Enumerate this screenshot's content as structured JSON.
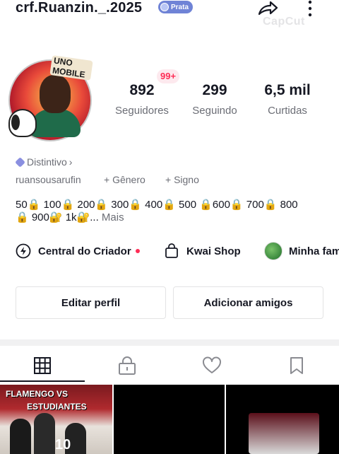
{
  "header": {
    "username": "crf.Ruanzin._.2025",
    "badge_label": "Prata",
    "watermark": "CapCut"
  },
  "profile": {
    "avatar_text": "UNO MOBILE",
    "notification_badge": "99+",
    "stats": [
      {
        "value": "892",
        "label": "Seguidores"
      },
      {
        "value": "299",
        "label": "Seguindo"
      },
      {
        "value": "6,5 mil",
        "label": "Curtidas"
      }
    ],
    "distintivo_label": "Distintivo",
    "distintivo_chevron": "›",
    "handle": "ruansousarufin",
    "add_gender": "+ Gênero",
    "add_sign": "+ Signo",
    "bio_line1": "50🔒 100🔒 200🔒 300🔒 400🔒 500 🔒600🔒 700🔒 800",
    "bio_line2": "🔒 900🔐 1k🔐...",
    "bio_more": "Mais"
  },
  "shortcuts": [
    {
      "label": "Central do Criador",
      "icon": "lightning-icon"
    },
    {
      "label": "Kwai Shop",
      "icon": "shopping-bag-icon"
    },
    {
      "label": "Minha família",
      "icon": "family-avatar-icon"
    }
  ],
  "actions": {
    "edit_profile": "Editar perfil",
    "add_friends": "Adicionar amigos"
  },
  "tabs": [
    {
      "name": "grid-tab",
      "icon": "grid-icon",
      "active": true
    },
    {
      "name": "private-tab",
      "icon": "lock-icon",
      "active": false
    },
    {
      "name": "likes-tab",
      "icon": "heart-icon",
      "active": false
    },
    {
      "name": "saved-tab",
      "icon": "bookmark-icon",
      "active": false
    }
  ],
  "posts": [
    {
      "title_line1": "FLAMENGO VS",
      "title_line2": "ESTUDIANTES",
      "jersey_number": "10"
    },
    {},
    {}
  ],
  "colors": {
    "accent": "#fe2c55",
    "badge_prata": "#6f83d6",
    "text_primary": "#161823",
    "text_secondary": "#6b6d75"
  }
}
